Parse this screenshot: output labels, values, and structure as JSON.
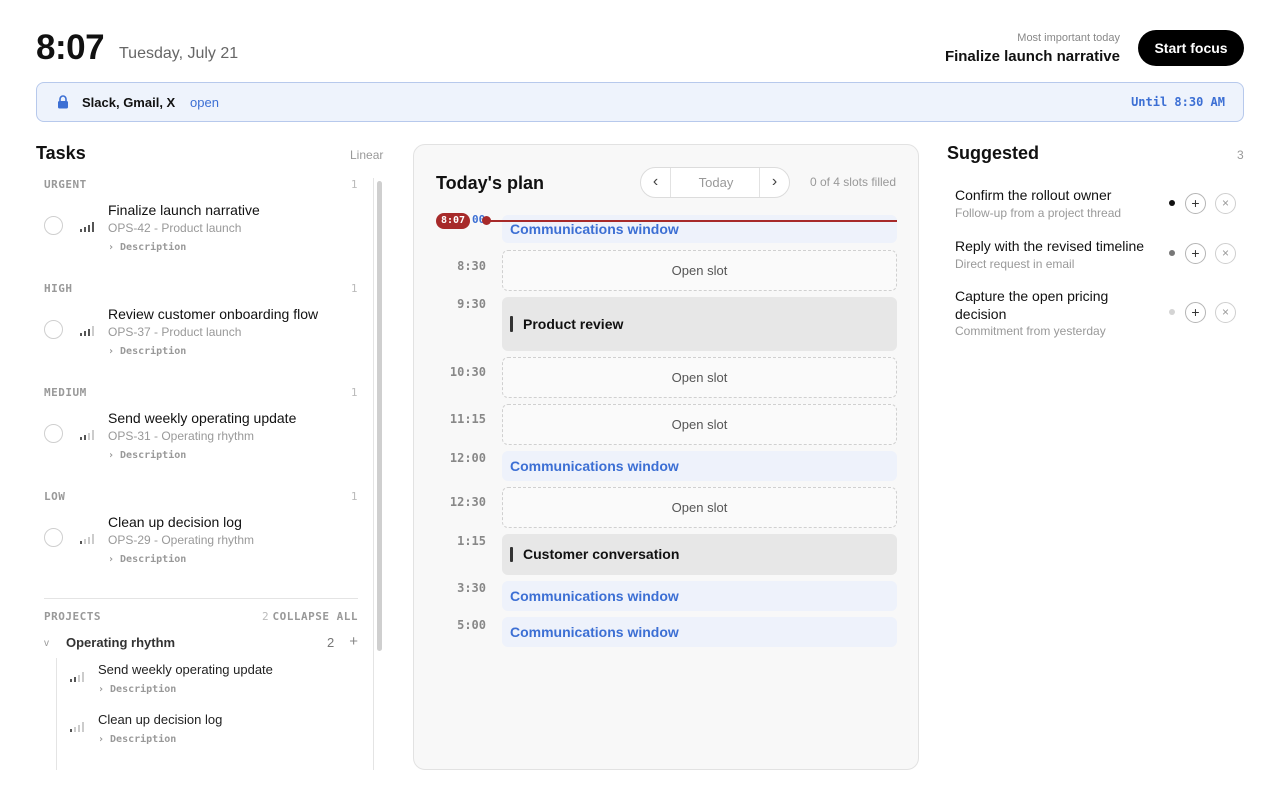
{
  "header": {
    "time": "8:07",
    "date": "Tuesday, July 21",
    "mit_caption": "Most important today",
    "mit_title": "Finalize launch narrative",
    "start_focus_label": "Start focus"
  },
  "banner": {
    "apps": "Slack, Gmail, X",
    "open_label": "open",
    "until": "Until 8:30 AM",
    "accent_color": "#3c6fd4"
  },
  "tasks": {
    "title": "Tasks",
    "source": "Linear",
    "groups": [
      {
        "label": "URGENT",
        "count": "1",
        "task": {
          "title": "Finalize launch narrative",
          "meta": "OPS-42 - Product launch",
          "desc": "› Description",
          "priority_level": 4
        }
      },
      {
        "label": "HIGH",
        "count": "1",
        "task": {
          "title": "Review customer onboarding flow",
          "meta": "OPS-37 - Product launch",
          "desc": "› Description",
          "priority_level": 3
        }
      },
      {
        "label": "MEDIUM",
        "count": "1",
        "task": {
          "title": "Send weekly operating update",
          "meta": "OPS-31 - Operating rhythm",
          "desc": "› Description",
          "priority_level": 2
        }
      },
      {
        "label": "LOW",
        "count": "1",
        "task": {
          "title": "Clean up decision log",
          "meta": "OPS-29 - Operating rhythm",
          "desc": "› Description",
          "priority_level": 1
        }
      }
    ],
    "projects": {
      "label": "PROJECTS",
      "count": "2",
      "collapse_label": "COLLAPSE ALL",
      "items": [
        {
          "chevron": "v",
          "name": "Operating rhythm",
          "count": "2",
          "add": "+",
          "tasks": [
            {
              "title": "Send weekly operating update",
              "desc": "› Description"
            },
            {
              "title": "Clean up decision log",
              "desc": "› Description"
            }
          ]
        }
      ]
    }
  },
  "plan": {
    "title": "Today's plan",
    "nav_prev": "‹",
    "nav_today": "Today",
    "nav_next": "›",
    "slots_filled": "0 of 4 slots filled",
    "now_tag": "8:07",
    "now_under": "00",
    "now_color": "#a72a2a",
    "rows": [
      {
        "time": "",
        "kind": "comm",
        "label": "Communications window"
      },
      {
        "time": "8:30",
        "kind": "open",
        "label": "Open slot"
      },
      {
        "time": "9:30",
        "kind": "event",
        "label": "Product review"
      },
      {
        "time": "10:30",
        "kind": "open",
        "label": "Open slot"
      },
      {
        "time": "11:15",
        "kind": "open",
        "label": "Open slot"
      },
      {
        "time": "12:00",
        "kind": "comm",
        "label": "Communications window"
      },
      {
        "time": "12:30",
        "kind": "open",
        "label": "Open slot"
      },
      {
        "time": "1:15",
        "kind": "event",
        "label": "Customer conversation"
      },
      {
        "time": "3:30",
        "kind": "comm",
        "label": "Communications window"
      },
      {
        "time": "5:00",
        "kind": "comm",
        "label": "Communications window"
      }
    ]
  },
  "suggested": {
    "title": "Suggested",
    "count": "3",
    "items": [
      {
        "text": "Confirm the rollout owner",
        "sub": "Follow-up from a project thread",
        "dot_color": "#111111",
        "add": "+",
        "dismiss": "×"
      },
      {
        "text": "Reply with the revised timeline",
        "sub": "Direct request in email",
        "dot_color": "#777777",
        "add": "+",
        "dismiss": "×"
      },
      {
        "text": "Capture the open pricing decision",
        "sub": "Commitment from yesterday",
        "dot_color": "#d4d4d4",
        "add": "+",
        "dismiss": "×"
      }
    ]
  }
}
